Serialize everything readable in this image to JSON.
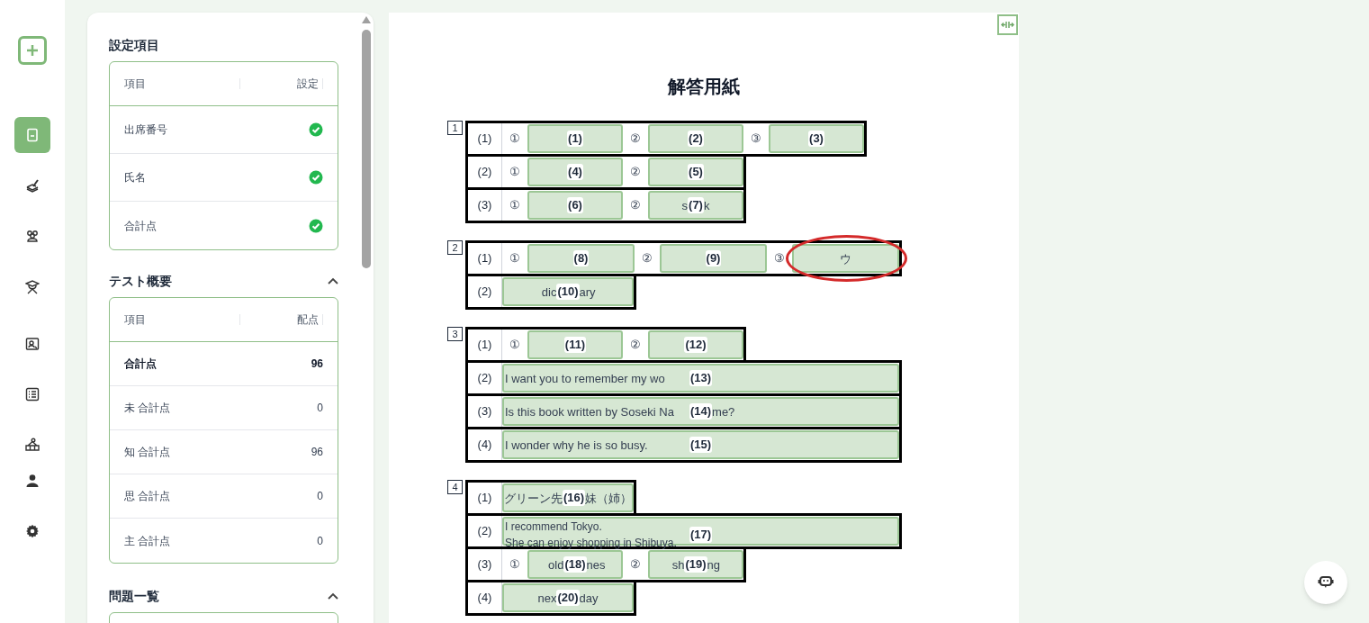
{
  "nav": [
    {
      "selected": true
    },
    {
      "selected": false
    },
    {
      "selected": false
    },
    {
      "selected": false
    },
    {
      "selected": false
    },
    {
      "selected": false
    },
    {
      "selected": false
    },
    {
      "selected": false
    },
    {
      "selected": false
    }
  ],
  "settings": {
    "title": "設定項目",
    "columns": [
      "項目",
      "設定"
    ],
    "rows": [
      {
        "label": "出席番号",
        "checked": true
      },
      {
        "label": "氏名",
        "checked": true
      },
      {
        "label": "合計点",
        "checked": true
      }
    ]
  },
  "overview": {
    "title": "テスト概要",
    "expanded": true,
    "columns": [
      "項目",
      "配点"
    ],
    "rows": [
      {
        "label": "合計点",
        "value": "96",
        "emphasized": true
      },
      {
        "label": "未 合計点",
        "value": "0",
        "emphasized": false
      },
      {
        "label": "知 合計点",
        "value": "96",
        "emphasized": false
      },
      {
        "label": "思 合計点",
        "value": "0",
        "emphasized": false
      },
      {
        "label": "主 合計点",
        "value": "0",
        "emphasized": false
      }
    ]
  },
  "problems": {
    "title": "問題一覧",
    "expanded": true
  },
  "sheet": {
    "title": "解答用紙",
    "sections": [
      {
        "number": "1",
        "rows": [
          {
            "label": "(1)",
            "cells": [
              {
                "kind": "mark",
                "text": "①"
              },
              {
                "kind": "short",
                "badge": "(1)",
                "circled": false
              },
              {
                "kind": "mark",
                "text": "②"
              },
              {
                "kind": "short",
                "badge": "(2)",
                "circled": false
              },
              {
                "kind": "mark",
                "text": "③"
              },
              {
                "kind": "short",
                "badge": "(3)",
                "circled": false
              }
            ]
          },
          {
            "label": "(2)",
            "cells": [
              {
                "kind": "mark",
                "text": "①"
              },
              {
                "kind": "short",
                "badge": "(4)",
                "circled": false
              },
              {
                "kind": "mark",
                "text": "②"
              },
              {
                "kind": "short",
                "badge": "(5)",
                "circled": false
              }
            ]
          },
          {
            "label": "(3)",
            "cells": [
              {
                "kind": "mark",
                "text": "①"
              },
              {
                "kind": "short",
                "badge": "(6)",
                "circled": false
              },
              {
                "kind": "mark",
                "text": "②"
              },
              {
                "kind": "short",
                "before": "s",
                "badge": "(7)",
                "after": "k",
                "circled": false
              }
            ]
          }
        ]
      },
      {
        "number": "2",
        "rows": [
          {
            "label": "(1)",
            "cells": [
              {
                "kind": "mark",
                "text": "①"
              },
              {
                "kind": "medium",
                "badge": "(8)",
                "circled": false
              },
              {
                "kind": "mark",
                "text": "②"
              },
              {
                "kind": "medium",
                "badge": "(9)",
                "circled": false
              },
              {
                "kind": "mark",
                "text": "③"
              },
              {
                "kind": "medium",
                "before": "ウ",
                "circled": true
              }
            ]
          },
          {
            "label": "(2)",
            "cells": [
              {
                "kind": "long",
                "colspan": 2,
                "before": "dic",
                "badge": "(10)",
                "after": "ary",
                "circled": false
              }
            ]
          }
        ]
      },
      {
        "number": "3",
        "rows": [
          {
            "label": "(1)",
            "cells": [
              {
                "kind": "mark",
                "text": "①"
              },
              {
                "kind": "short",
                "badge": "(11)",
                "circled": false
              },
              {
                "kind": "mark",
                "text": "②"
              },
              {
                "kind": "short",
                "badge": "(12)",
                "circled": false
              }
            ]
          },
          {
            "label": "(2)",
            "cells": [
              {
                "kind": "full",
                "colspan": 4,
                "before": "I want you to remember my wo",
                "badge": "(13)",
                "circled": false
              }
            ]
          },
          {
            "label": "(3)",
            "cells": [
              {
                "kind": "full",
                "colspan": 4,
                "before": "Is this book written by Soseki Na",
                "badge": "(14)",
                "after": "me?",
                "circled": false
              }
            ]
          },
          {
            "label": "(4)",
            "cells": [
              {
                "kind": "full",
                "colspan": 4,
                "before": "I wonder why he is so busy.",
                "badge": "(15)",
                "circled": false
              }
            ]
          }
        ]
      },
      {
        "number": "4",
        "rows": [
          {
            "label": "(1)",
            "cells": [
              {
                "kind": "long",
                "colspan": 2,
                "before": "グリーン先",
                "badge": "(16)",
                "after": "妹（姉）",
                "circled": false
              }
            ]
          },
          {
            "label": "(2)",
            "cells": [
              {
                "kind": "full",
                "colspan": 4,
                "lines": [
                  "I recommend Tokyo.",
                  "She can enjoy shopping in Shibuya."
                ],
                "badge": "(17)",
                "circled": false
              }
            ]
          },
          {
            "label": "(3)",
            "cells": [
              {
                "kind": "mark",
                "text": "①"
              },
              {
                "kind": "short",
                "before": "old",
                "badge": "(18)",
                "after": "nes",
                "circled": false
              },
              {
                "kind": "mark",
                "text": "②"
              },
              {
                "kind": "short",
                "before": "sh",
                "badge": "(19)",
                "after": "ng",
                "circled": false
              }
            ]
          },
          {
            "label": "(4)",
            "cells": [
              {
                "kind": "long",
                "colspan": 2,
                "before": "nex",
                "badge": "(20)",
                "after": "day",
                "circled": false
              }
            ]
          }
        ]
      }
    ]
  }
}
